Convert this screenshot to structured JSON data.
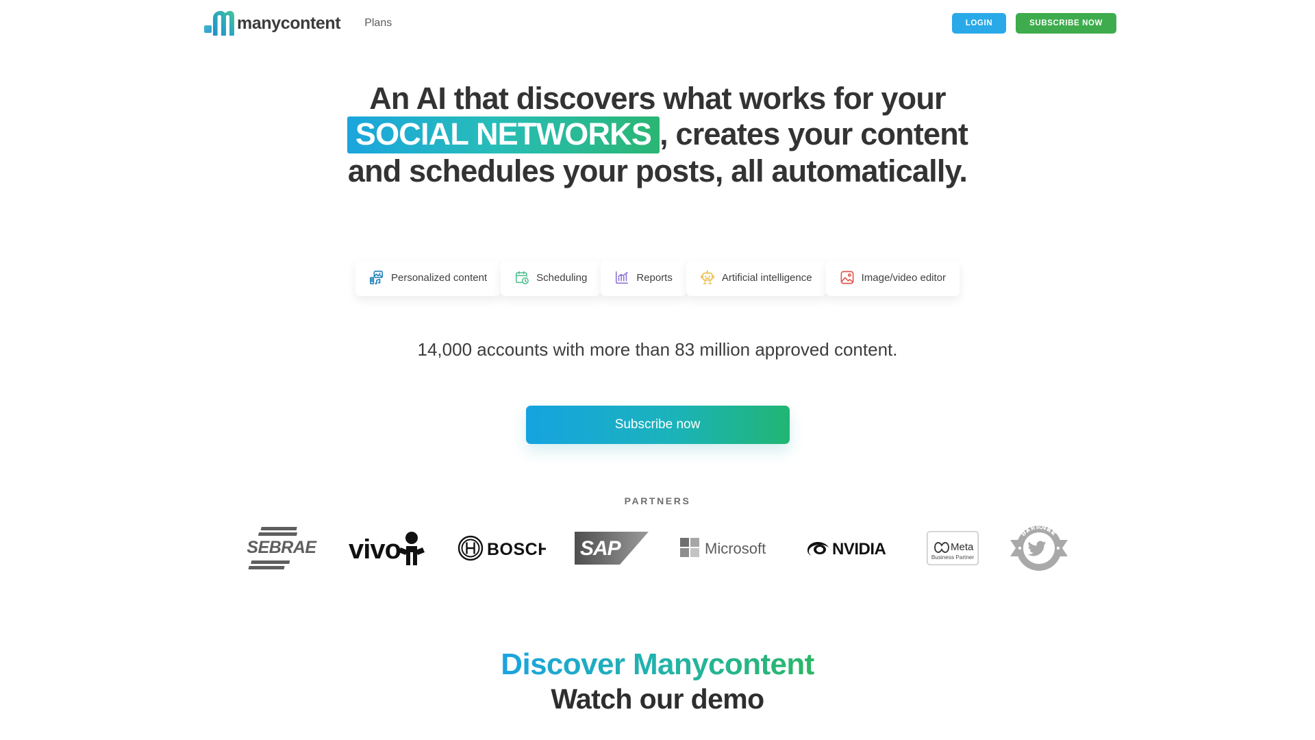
{
  "brand": {
    "name": "manycontent",
    "logo_icon": "manycontent-m-logo",
    "gradient_start": "#3fc0a8",
    "gradient_end": "#1f8fd0"
  },
  "header": {
    "nav": [
      {
        "label": "Plans",
        "name": "nav-plans"
      }
    ],
    "login_label": "LOGIN",
    "login_color": "#29a9e8",
    "subscribe_label": "SUBSCRIBE NOW",
    "subscribe_color": "#3eac4d"
  },
  "hero": {
    "line1": "An AI that discovers what works for your",
    "highlight": "SOCIAL NETWORKS",
    "line2_after": ", creates your content",
    "line3": "and schedules your posts, all automatically.",
    "highlight_gradient_start": "#1ba5dd",
    "highlight_gradient_end": "#2bb673"
  },
  "features": [
    {
      "label": "Personalized content",
      "icon": "personalized-content-icon",
      "color": "#1b7fb8"
    },
    {
      "label": "Scheduling",
      "icon": "calendar-clock-icon",
      "color": "#4cbd8c"
    },
    {
      "label": "Reports",
      "icon": "bar-chart-icon",
      "color": "#8b6fd4"
    },
    {
      "label": "Artificial intelligence",
      "icon": "robot-icon",
      "color": "#edbb3e"
    },
    {
      "label": "Image/video editor",
      "icon": "image-icon",
      "color": "#e0564f"
    }
  ],
  "stats": {
    "text": "14,000 accounts with more than 83 million approved content."
  },
  "cta": {
    "label": "Subscribe now",
    "gradient_start": "#16a3e0",
    "gradient_end": "#21b573"
  },
  "partners": {
    "title": "PARTNERS",
    "logos": [
      {
        "name": "sebrae",
        "label": "SEBRAE"
      },
      {
        "name": "vivo",
        "label": "vivo"
      },
      {
        "name": "bosch",
        "label": "BOSCH"
      },
      {
        "name": "sap",
        "label": "SAP"
      },
      {
        "name": "microsoft",
        "label": "Microsoft"
      },
      {
        "name": "nvidia",
        "label": "NVIDIA"
      },
      {
        "name": "meta",
        "label": "Meta",
        "sublabel": "Business Partner"
      },
      {
        "name": "twitter",
        "label": "OFFICIAL PARTNER"
      }
    ]
  },
  "demo": {
    "title_gradient": "Discover Manycontent",
    "title_plain": "Watch our demo"
  }
}
